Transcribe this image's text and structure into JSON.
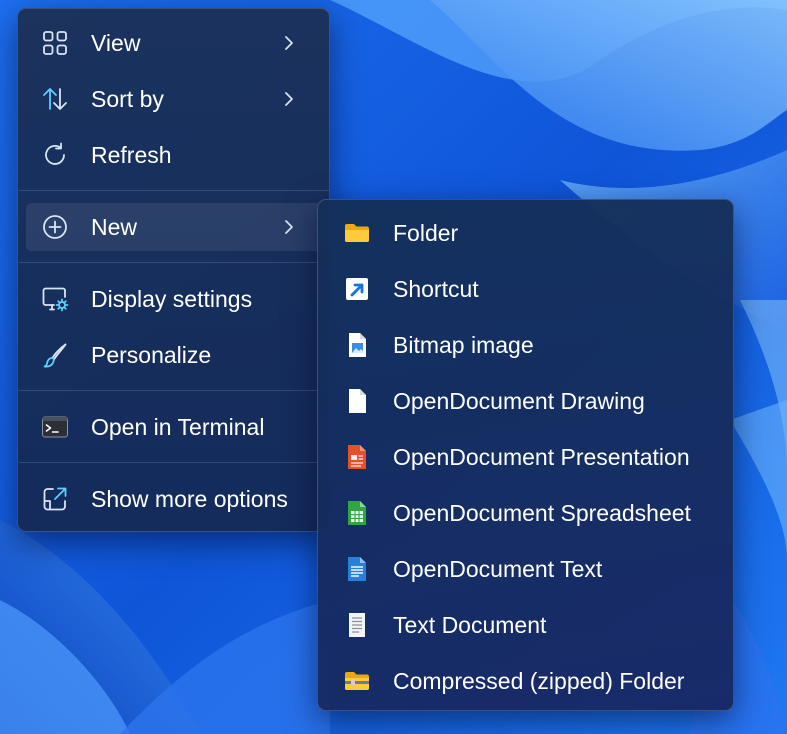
{
  "context_menu": {
    "items": [
      {
        "label": "View",
        "icon": "grid-view-icon",
        "has_submenu": true
      },
      {
        "label": "Sort by",
        "icon": "sort-arrows-icon",
        "has_submenu": true
      },
      {
        "label": "Refresh",
        "icon": "refresh-icon",
        "has_submenu": false
      },
      {
        "label": "New",
        "icon": "plus-circle-icon",
        "has_submenu": true,
        "highlighted": true
      },
      {
        "label": "Display settings",
        "icon": "display-settings-icon",
        "has_submenu": false
      },
      {
        "label": "Personalize",
        "icon": "brush-icon",
        "has_submenu": false
      },
      {
        "label": "Open in Terminal",
        "icon": "terminal-icon",
        "has_submenu": false
      },
      {
        "label": "Show more options",
        "icon": "open-external-icon",
        "has_submenu": false
      }
    ]
  },
  "new_submenu": {
    "items": [
      {
        "label": "Folder",
        "icon": "folder-icon"
      },
      {
        "label": "Shortcut",
        "icon": "shortcut-icon"
      },
      {
        "label": "Bitmap image",
        "icon": "bitmap-image-icon"
      },
      {
        "label": "OpenDocument Drawing",
        "icon": "odg-document-icon"
      },
      {
        "label": "OpenDocument Presentation",
        "icon": "odp-presentation-icon"
      },
      {
        "label": "OpenDocument Spreadsheet",
        "icon": "ods-spreadsheet-icon"
      },
      {
        "label": "OpenDocument Text",
        "icon": "odt-text-icon"
      },
      {
        "label": "Text Document",
        "icon": "text-document-icon"
      },
      {
        "label": "Compressed (zipped) Folder",
        "icon": "zip-folder-icon"
      }
    ]
  },
  "colors": {
    "menu_background": "#1b2e52",
    "text": "#ffffff",
    "icon_accent": "#60cdff",
    "wallpaper_blue": "#1a63e6"
  }
}
